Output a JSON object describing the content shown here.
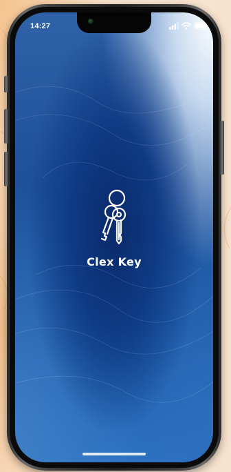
{
  "status_bar": {
    "time": "14:27",
    "icons": [
      "signal-icon",
      "wifi-icon",
      "battery-icon"
    ]
  },
  "splash": {
    "logo_icon": "keys-icon",
    "app_name": "Clex Key"
  },
  "colors": {
    "screen_primary": "#1d4f99",
    "screen_center": "#0a2a6a",
    "screen_highlight": "#ffffff",
    "text": "#ffffff",
    "background_warm": "#f7dcc0"
  }
}
